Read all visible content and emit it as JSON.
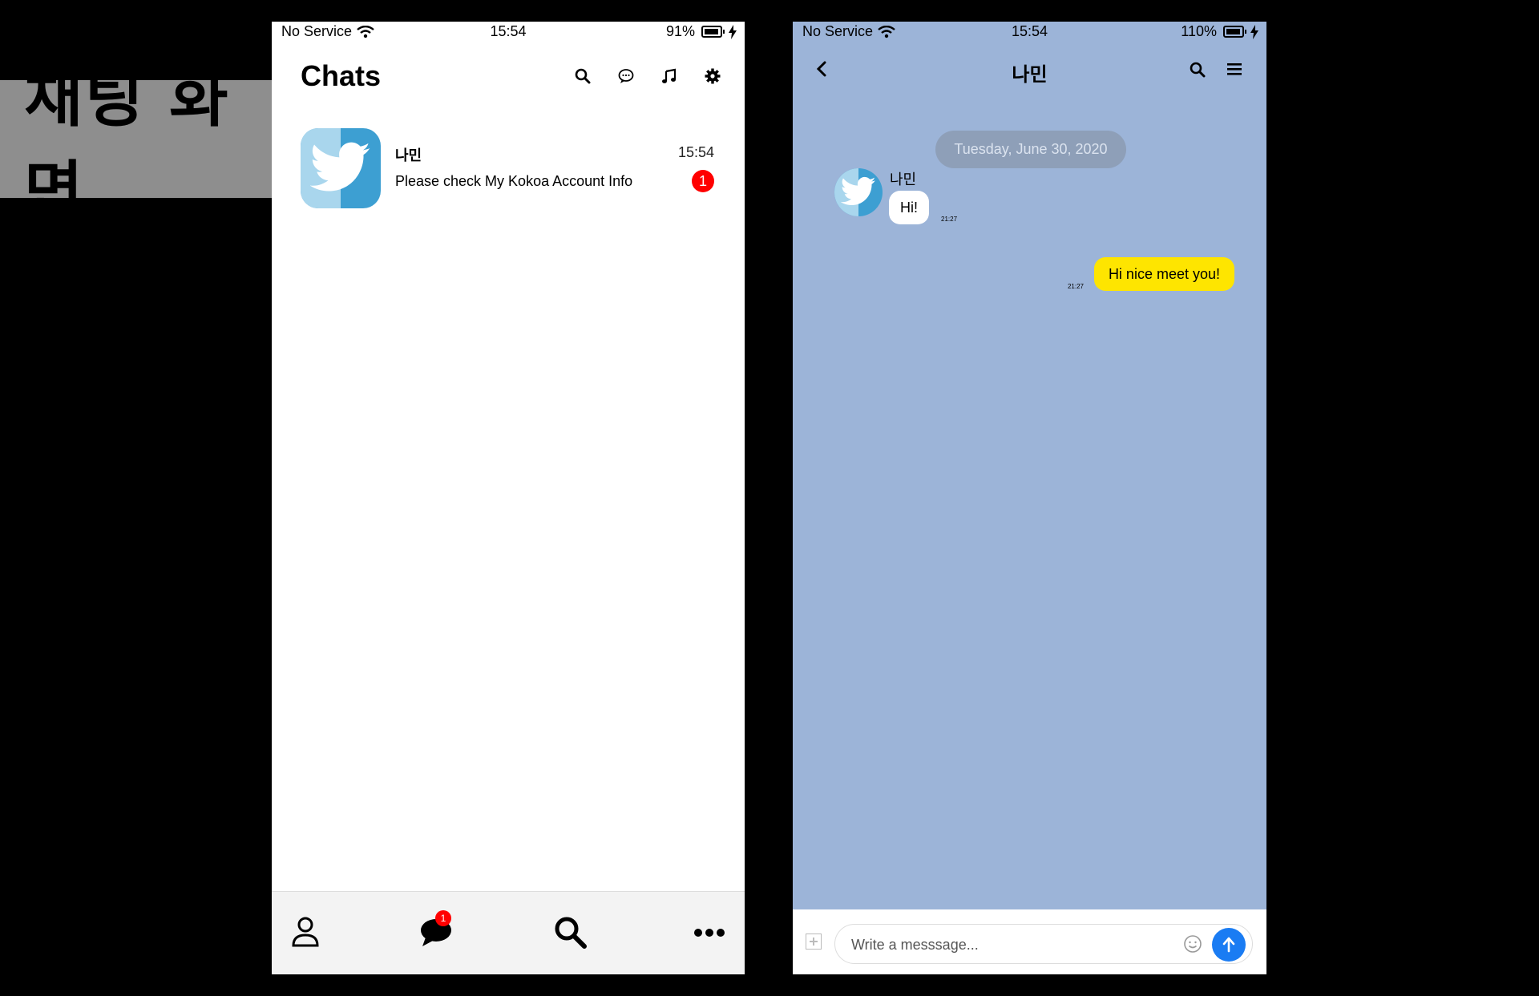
{
  "banner": {
    "label": "채팅 화면"
  },
  "chat_list": {
    "status": {
      "carrier": "No Service",
      "time": "15:54",
      "battery": "91%"
    },
    "title": "Chats",
    "header_icons": [
      "search-icon",
      "chat-bubble-icon",
      "music-note-icon",
      "gear-icon"
    ],
    "rows": [
      {
        "name": "나민",
        "time": "15:54",
        "preview": "Please check My Kokoa Account Info",
        "unread": "1"
      }
    ],
    "tabbar": {
      "tabs": [
        "profile-icon",
        "chats-icon",
        "search-icon",
        "more-icon"
      ],
      "chats_badge": "1"
    }
  },
  "conversation": {
    "status": {
      "carrier": "No Service",
      "time": "15:54",
      "battery": "110%"
    },
    "title": "나민",
    "date_divider": "Tuesday, June 30, 2020",
    "messages": [
      {
        "direction": "in",
        "sender": "나민",
        "text": "Hi!",
        "time": "21:27"
      },
      {
        "direction": "out",
        "text": "Hi nice meet you!",
        "time": "21:27"
      }
    ],
    "composer": {
      "placeholder": "Write a messsage..."
    }
  },
  "colors": {
    "chat_bg": "#9cb4d8",
    "outgoing_bubble": "#fee500",
    "send_button": "#1a7cf3",
    "unread_badge": "#ff0000",
    "twitter_blue": "#3d9fd2"
  }
}
